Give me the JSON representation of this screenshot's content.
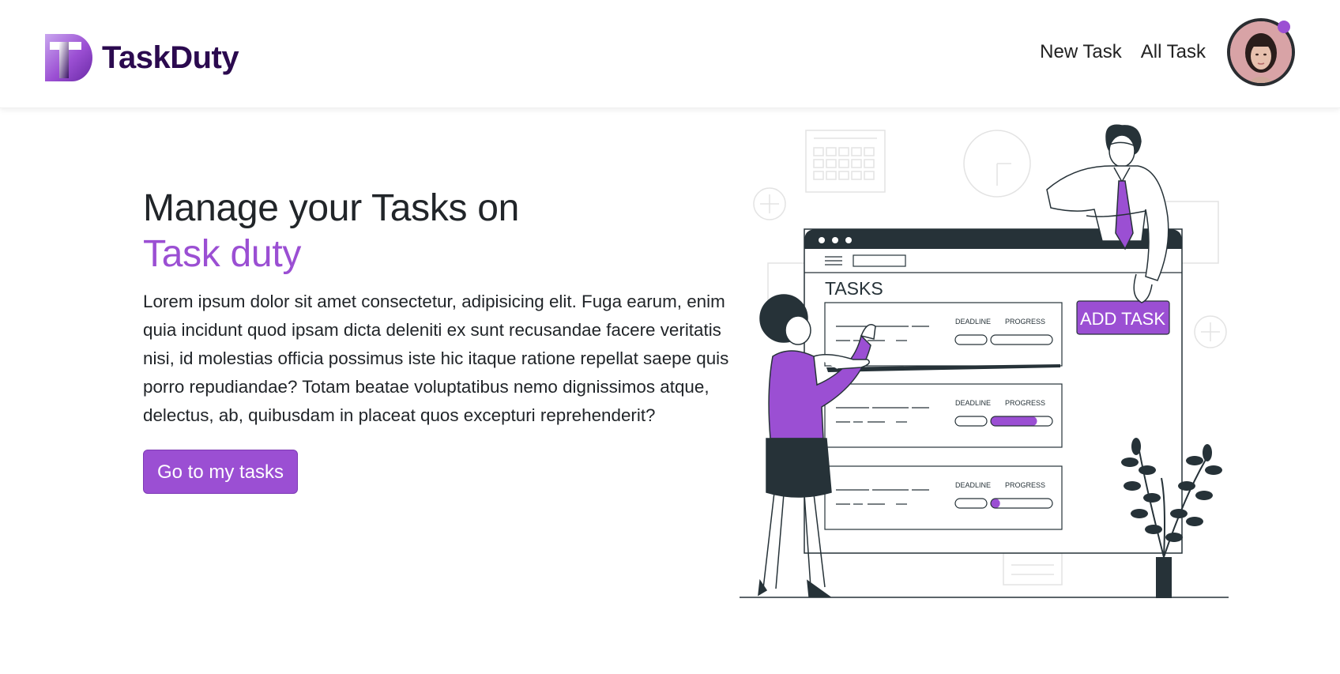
{
  "header": {
    "brand_name": "TaskDuty",
    "logo_letter": "T",
    "nav": [
      {
        "label": "New Task"
      },
      {
        "label": "All Task"
      }
    ],
    "notification_color": "#9b4fd3"
  },
  "hero": {
    "title_line1": "Manage your Tasks on",
    "title_line2": "Task duty",
    "description": "Lorem ipsum dolor sit amet consectetur, adipisicing elit. Fuga earum, enim quia incidunt quod ipsam dicta deleniti ex sunt recusandae facere veritatis nisi, id molestias officia possimus iste hic itaque ratione repellat saepe quis porro repudiandae? Totam beatae voluptatibus nemo dignissimos atque, delectus, ab, quibusdam in placeat quos excepturi reprehenderit?",
    "cta_label": "Go to my tasks"
  },
  "illustration": {
    "board_title": "TASKS",
    "add_button_label": "ADD TASK",
    "cards": [
      {
        "deadline_label": "DEADLINE",
        "progress_label": "PROGRESS",
        "progress": 0
      },
      {
        "deadline_label": "DEADLINE",
        "progress_label": "PROGRESS",
        "progress": 0.75
      },
      {
        "deadline_label": "DEADLINE",
        "progress_label": "PROGRESS",
        "progress": 0.15
      }
    ]
  },
  "colors": {
    "accent": "#9b4fd3",
    "brand_dark": "#2b0a4f",
    "ink": "#263238"
  }
}
